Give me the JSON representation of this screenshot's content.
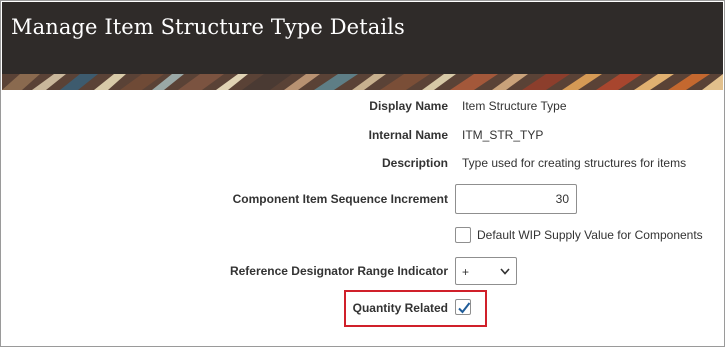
{
  "page": {
    "title": "Manage Item Structure Type Details"
  },
  "form": {
    "display_name": {
      "label": "Display Name",
      "value": "Item Structure Type"
    },
    "internal_name": {
      "label": "Internal Name",
      "value": "ITM_STR_TYP"
    },
    "description": {
      "label": "Description",
      "value": "Type used for creating structures for items"
    },
    "component_item_sequence_increment": {
      "label": "Component Item Sequence Increment",
      "value": "30"
    },
    "default_wip_supply": {
      "label": "Default WIP Supply Value for Components",
      "checked": false
    },
    "reference_designator_range_indicator": {
      "label": "Reference Designator Range Indicator",
      "selected": "+",
      "icon": "chevron-down-icon"
    },
    "quantity_related": {
      "label": "Quantity Related",
      "checked": true,
      "icon": "checkmark-icon"
    }
  },
  "colors": {
    "header_background": "#2f2b29",
    "highlight_border": "#d0202a",
    "checkmark": "#1f5c99"
  }
}
